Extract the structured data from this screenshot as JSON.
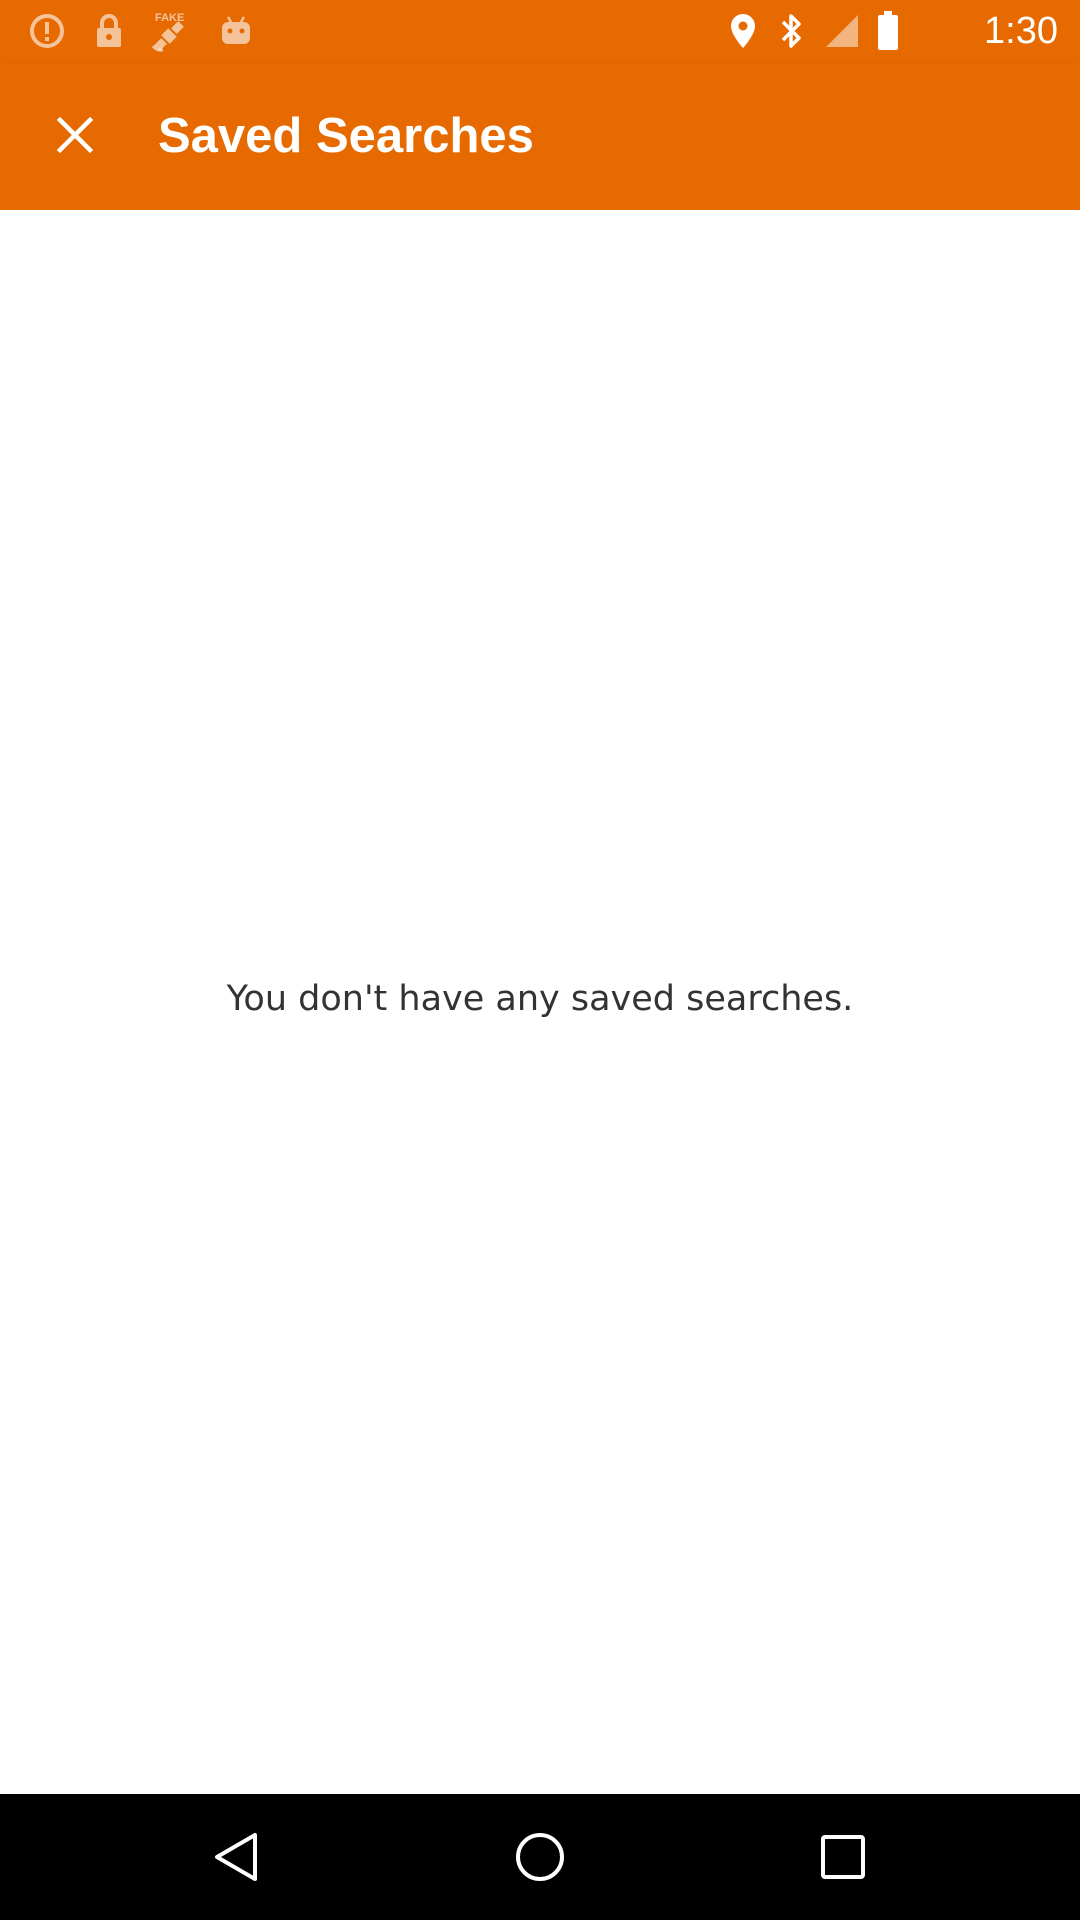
{
  "status_bar": {
    "time": "1:30",
    "icons_left": [
      "alert-circle-icon",
      "lock-icon",
      "fake-gps-satellite-icon",
      "android-icon"
    ],
    "icons_right": [
      "location-pin-icon",
      "bluetooth-icon",
      "signal-icon",
      "battery-icon"
    ]
  },
  "app_bar": {
    "title": "Saved Searches",
    "close_icon": "close-icon",
    "background_color": "#E66A00"
  },
  "content": {
    "empty_message": "You don't have any saved searches."
  },
  "nav_bar": {
    "buttons": [
      "back-icon",
      "home-icon",
      "recents-icon"
    ]
  }
}
